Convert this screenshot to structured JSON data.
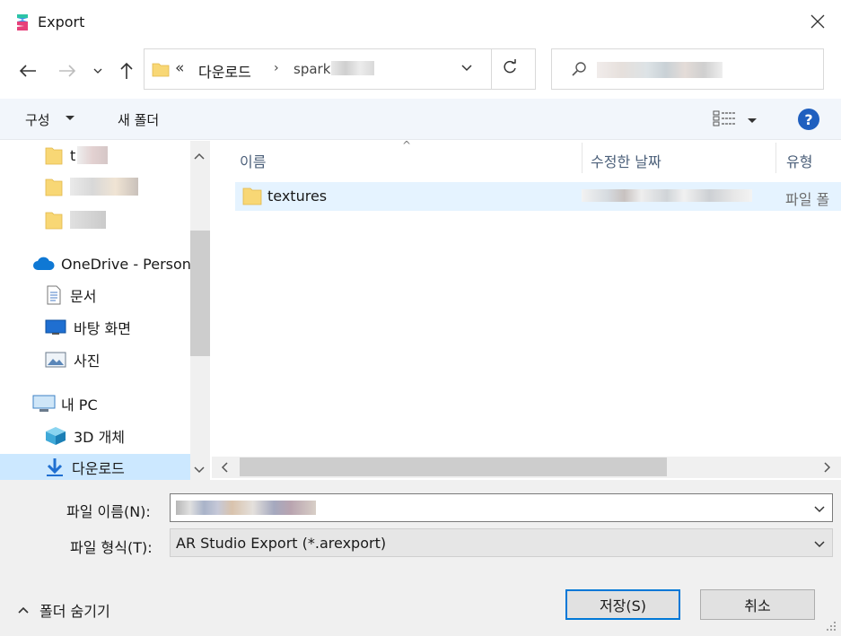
{
  "window": {
    "title": "Export",
    "close_glyph": "✕"
  },
  "nav": {
    "back_glyph": "←",
    "forward_glyph": "→",
    "recent_glyph": "⌄",
    "up_glyph": "↑"
  },
  "address": {
    "overflow_glyph": "«",
    "segment1": "다운로드",
    "separator": "›",
    "segment2": "spark",
    "dropdown_glyph": "⌄",
    "refresh_glyph": "↻"
  },
  "search": {
    "icon": "search-icon"
  },
  "commands": {
    "organize": "구성",
    "organize_chev": "▾",
    "new_folder": "새 폴더",
    "view_chev": "▾",
    "help": "?"
  },
  "tree": {
    "items": [
      {
        "label": "t",
        "icon": "folder-icon"
      },
      {
        "label": "",
        "icon": "folder-icon"
      },
      {
        "label": "",
        "icon": "folder-icon"
      },
      {
        "label": "OneDrive - Person",
        "icon": "cloud-icon"
      },
      {
        "label": "문서",
        "icon": "document-icon"
      },
      {
        "label": "바탕 화면",
        "icon": "desktop-icon"
      },
      {
        "label": "사진",
        "icon": "pictures-icon"
      },
      {
        "label": "내 PC",
        "icon": "computer-icon"
      },
      {
        "label": "3D 개체",
        "icon": "cube-icon"
      },
      {
        "label": "다운로드",
        "icon": "download-icon"
      }
    ],
    "scroll_up": "⌃",
    "scroll_down": "⌄"
  },
  "list": {
    "columns": [
      "이름",
      "수정한 날짜",
      "유형"
    ],
    "sort_caret": "^",
    "rows": [
      {
        "name": "textures",
        "type": "파일 폴"
      }
    ],
    "h_left": "‹",
    "h_right": "›"
  },
  "form": {
    "filename_label": "파일 이름(N):",
    "filetype_label": "파일 형식(T):",
    "filetype_value": "AR Studio Export (*.arexport)",
    "dd_glyph": "⌄"
  },
  "footer": {
    "hide_folders_glyph": "^",
    "hide_folders": "폴더 숨기기",
    "save": "저장(S)",
    "cancel": "취소"
  }
}
